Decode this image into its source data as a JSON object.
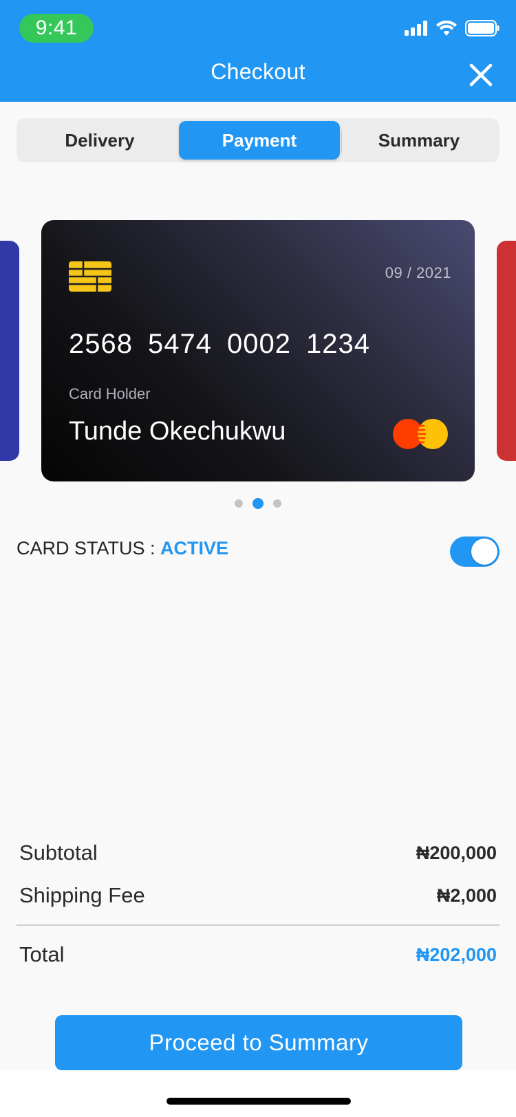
{
  "status_bar": {
    "time": "9:41"
  },
  "header": {
    "title": "Checkout",
    "close_icon": "close-icon"
  },
  "tabs": [
    {
      "label": "Delivery",
      "active": false
    },
    {
      "label": "Payment",
      "active": true
    },
    {
      "label": "Summary",
      "active": false
    }
  ],
  "card": {
    "expiry": "09 / 2021",
    "number_groups": [
      "2568",
      "5474",
      "0002",
      "1234"
    ],
    "holder_label": "Card Holder",
    "holder_name": "Tunde Okechukwu",
    "brand_icon": "mastercard-logo",
    "background": "#1a1a22"
  },
  "carousel": {
    "count": 3,
    "active_index": 1
  },
  "card_status": {
    "label": "CARD STATUS : ",
    "value": "ACTIVE",
    "enabled": true
  },
  "pricing": {
    "subtotal_label": "Subtotal",
    "subtotal": "₦200,000",
    "shipping_label": "Shipping Fee",
    "shipping": "₦2,000",
    "total_label": "Total",
    "total": "₦202,000"
  },
  "cta": {
    "label": "Proceed to Summary"
  },
  "colors": {
    "accent": "#2196f3",
    "status_pill": "#35c759",
    "left_card": "#2f3aa8",
    "right_card": "#cd3232"
  }
}
